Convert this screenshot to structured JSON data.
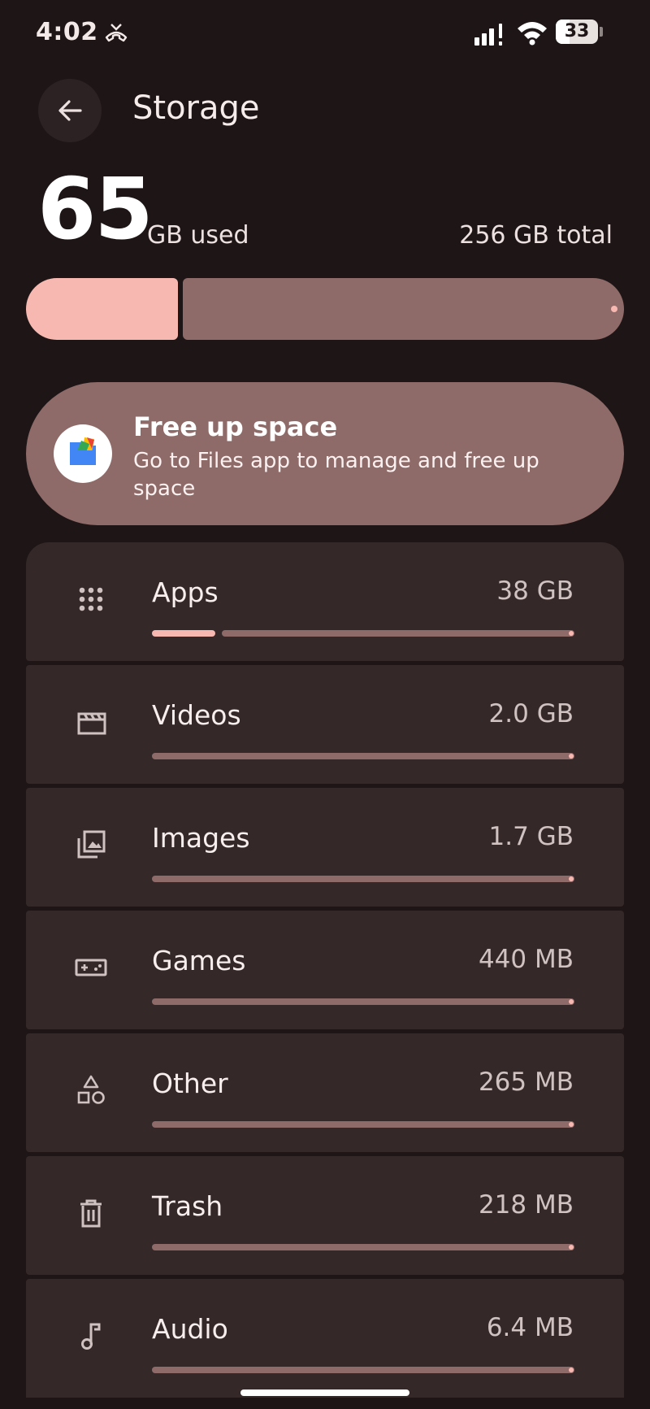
{
  "status_bar": {
    "time": "4:02",
    "battery": "33",
    "battery_level": 0.33
  },
  "header": {
    "title": "Storage"
  },
  "summary": {
    "used_value": "65",
    "used_unit": "GB used",
    "total": "256 GB total",
    "used_fraction": 0.254
  },
  "free_up": {
    "title": "Free up space",
    "subtitle": "Go to Files app to manage and free up space"
  },
  "categories": [
    {
      "label": "Apps",
      "size": "38 GB",
      "icon": "apps-grid-icon",
      "fraction": 0.15
    },
    {
      "label": "Videos",
      "size": "2.0 GB",
      "icon": "movie-clapper-icon",
      "fraction": 0
    },
    {
      "label": "Images",
      "size": "1.7 GB",
      "icon": "photo-library-icon",
      "fraction": 0
    },
    {
      "label": "Games",
      "size": "440 MB",
      "icon": "gamepad-icon",
      "fraction": 0
    },
    {
      "label": "Other",
      "size": "265 MB",
      "icon": "shapes-icon",
      "fraction": 0
    },
    {
      "label": "Trash",
      "size": "218 MB",
      "icon": "trash-icon",
      "fraction": 0
    },
    {
      "label": "Audio",
      "size": "6.4 MB",
      "icon": "music-note-icon",
      "fraction": 0
    }
  ],
  "colors": {
    "accent": "#f6b8b0",
    "track": "#8e6a68",
    "card": "#352829",
    "background": "#1d1516"
  }
}
